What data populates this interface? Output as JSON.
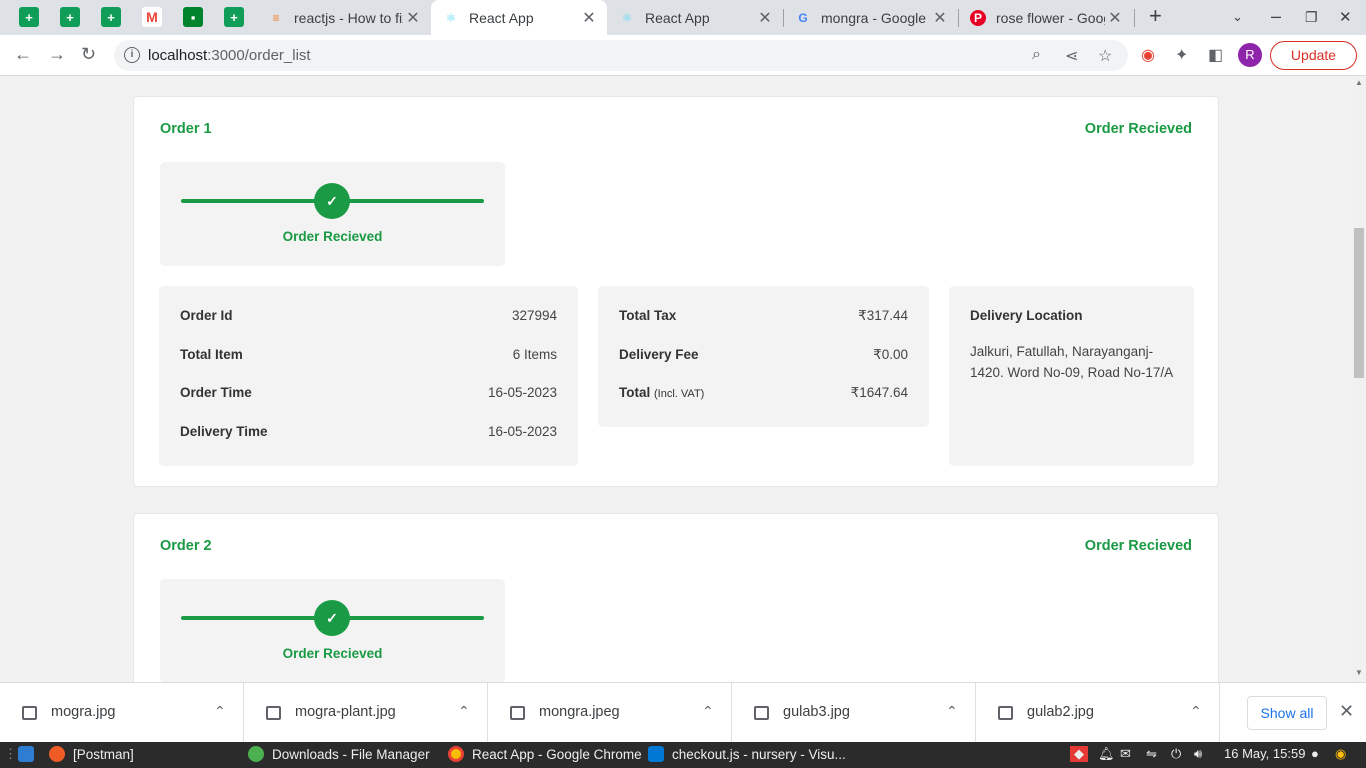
{
  "browser": {
    "tabs": [
      {
        "title": "reactjs - How to fix",
        "icon": "stackoverflow-icon",
        "active": false
      },
      {
        "title": "React App",
        "icon": "react-icon",
        "active": true
      },
      {
        "title": "React App",
        "icon": "react-icon",
        "active": false
      },
      {
        "title": "mongra - Google S",
        "icon": "google-icon",
        "active": false
      },
      {
        "title": "rose flower - Goog",
        "icon": "pinterest-icon",
        "active": false
      }
    ],
    "url_host": "localhost",
    "url_path": ":3000/order_list",
    "avatar_letter": "R",
    "update_label": "Update"
  },
  "orders": [
    {
      "title": "Order 1",
      "status": "Order Recieved",
      "progress_label": "Order Recieved",
      "details": {
        "order_id_label": "Order Id",
        "order_id": "327994",
        "total_item_label": "Total Item",
        "total_item": "6 Items",
        "order_time_label": "Order Time",
        "order_time": "16-05-2023",
        "delivery_time_label": "Delivery Time",
        "delivery_time": "16-05-2023"
      },
      "totals": {
        "tax_label": "Total Tax",
        "tax": "₹317.44",
        "fee_label": "Delivery Fee",
        "fee": "₹0.00",
        "total_label": "Total",
        "total_note": "(Incl. VAT)",
        "total": "₹1647.64"
      },
      "location": {
        "label": "Delivery Location",
        "address": "Jalkuri, Fatullah, Narayanganj-1420. Word No-09, Road No-17/A"
      }
    },
    {
      "title": "Order 2",
      "status": "Order Recieved",
      "progress_label": "Order Recieved"
    }
  ],
  "downloads": {
    "items": [
      "mogra.jpg",
      "mogra-plant.jpg",
      "mongra.jpeg",
      "gulab3.jpg",
      "gulab2.jpg"
    ],
    "show_all_label": "Show all"
  },
  "taskbar": {
    "tasks": [
      "[Postman]",
      "Downloads - File Manager",
      "React App - Google Chrome",
      "checkout.js - nursery - Visu..."
    ],
    "clock": "16 May, 15:59"
  },
  "colors": {
    "accent": "#1a9a44",
    "panel": "#f3f3f3"
  }
}
